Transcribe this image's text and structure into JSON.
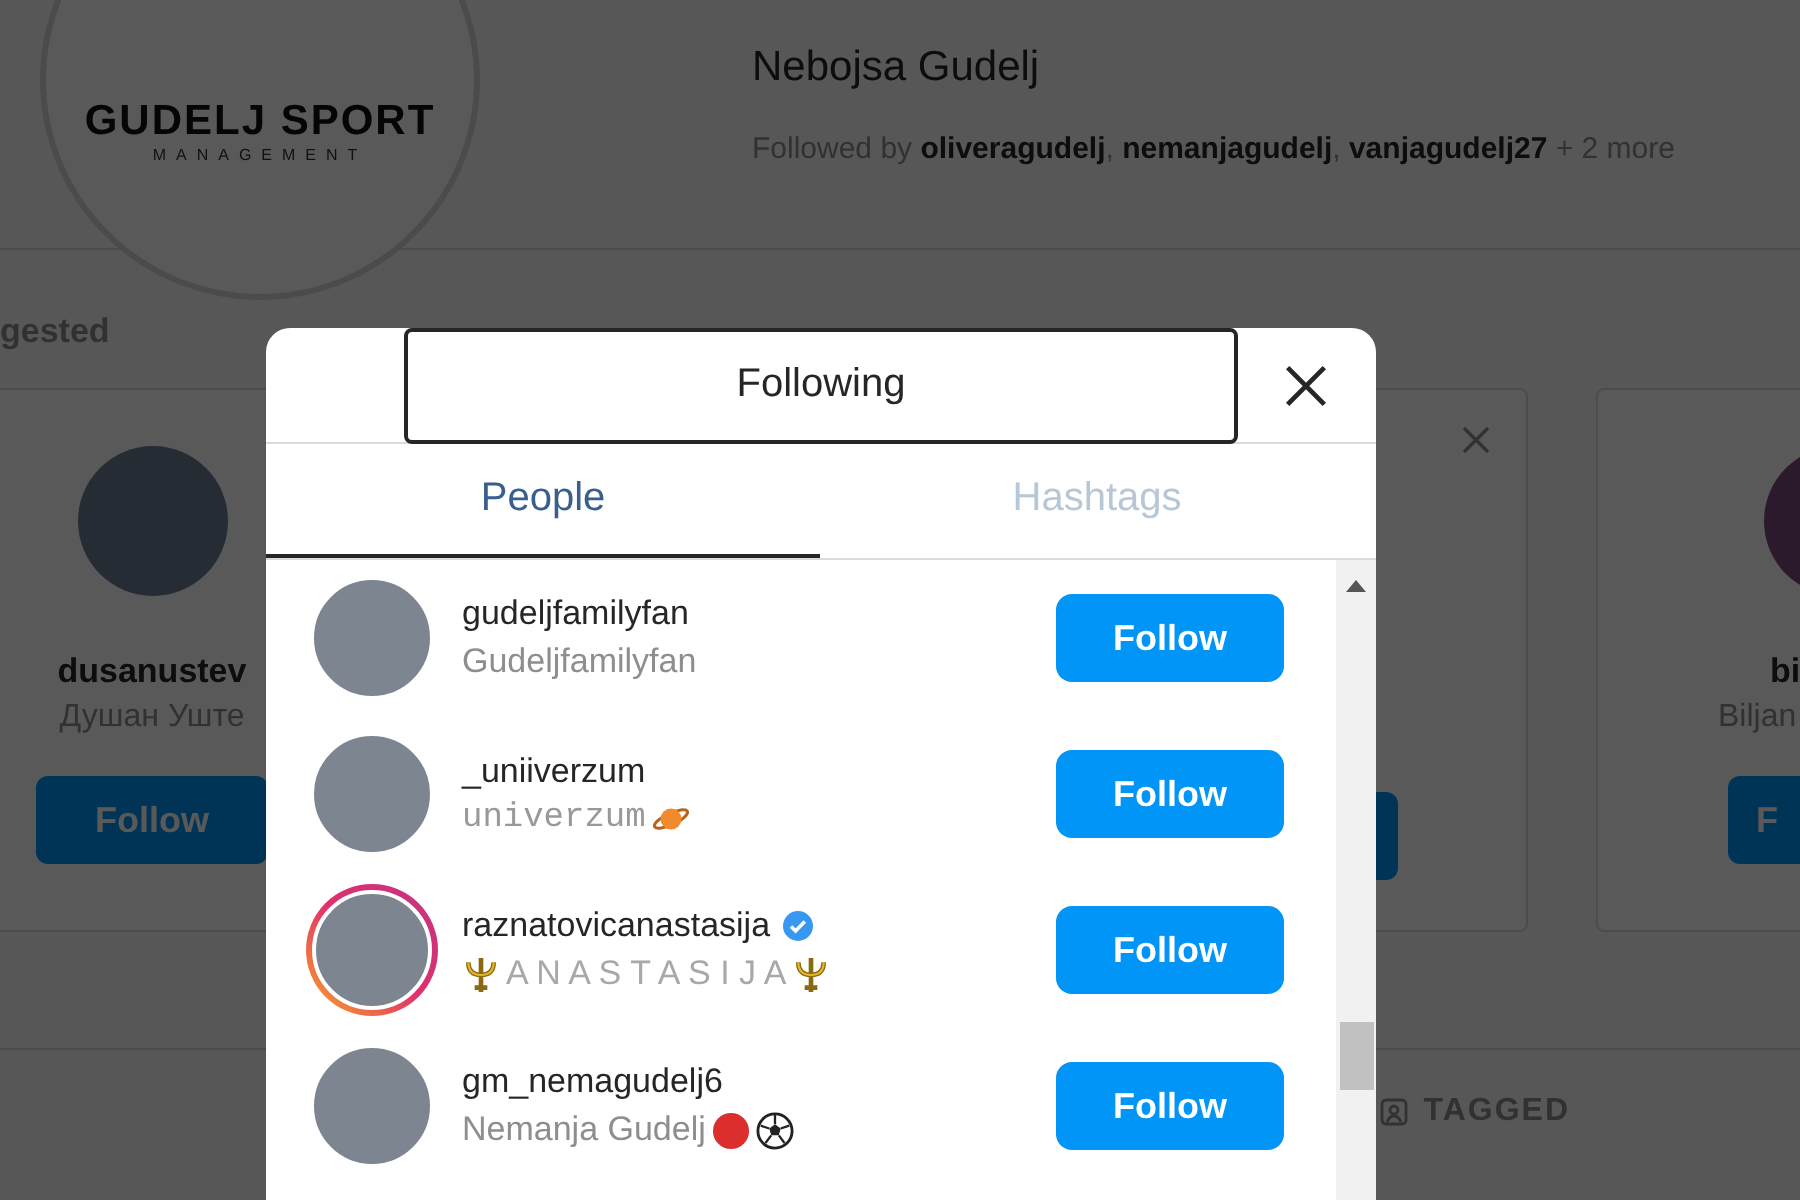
{
  "background": {
    "logo": {
      "title": "GUDELJ SPORT",
      "subtitle": "MANAGEMENT"
    },
    "profile_name": "Nebojsa Gudelj",
    "followed_by": "Followed by **oliveragudelj**, **nemanjagudelj**, **vanjagudelj27** + 2 more",
    "section_label": "gested",
    "suggestions": [
      {
        "username": "dusanustev",
        "name": "Душан Уште",
        "button": "Follow",
        "dismissible": false
      },
      {
        "dismissible": true
      },
      {
        "username": "bi",
        "name": "Biljan",
        "button": "F",
        "dismissible": false
      }
    ],
    "tab": "TAGGED"
  },
  "dialog": {
    "title": "Following",
    "tabs": [
      {
        "label": "People",
        "selected": true
      },
      {
        "label": "Hashtags",
        "selected": false
      }
    ],
    "rows": [
      {
        "username": "gudeljfamilyfan",
        "name": "Gudeljfamilyfan",
        "verified": false,
        "story": false,
        "kind": "plain",
        "button": "Follow"
      },
      {
        "username": "_uniiverzum",
        "name": "univerzum",
        "verified": false,
        "story": false,
        "kind": "planet",
        "button": "Follow"
      },
      {
        "username": "raznatovicanastasija",
        "name": "A N A S T A S I J A",
        "verified": true,
        "story": true,
        "kind": "trident",
        "button": "Follow"
      },
      {
        "username": "gm_nemagudelj6",
        "name": "Nemanja Gudelj",
        "verified": false,
        "story": false,
        "kind": "ball",
        "button": "Follow"
      }
    ]
  }
}
